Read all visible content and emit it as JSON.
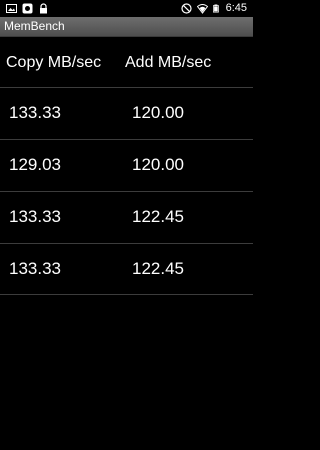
{
  "status_bar": {
    "time": "6:45",
    "left_icons": [
      "image-icon",
      "app-badge-icon",
      "lock-icon"
    ],
    "right_icons": [
      "do-not-disturb-icon",
      "wifi-icon",
      "battery-icon"
    ]
  },
  "app": {
    "title": "MemBench"
  },
  "table": {
    "headers": [
      "Copy MB/sec",
      "Add MB/sec"
    ],
    "rows": [
      [
        "133.33",
        "120.00"
      ],
      [
        "129.03",
        "120.00"
      ],
      [
        "133.33",
        "122.45"
      ],
      [
        "133.33",
        "122.45"
      ]
    ]
  }
}
